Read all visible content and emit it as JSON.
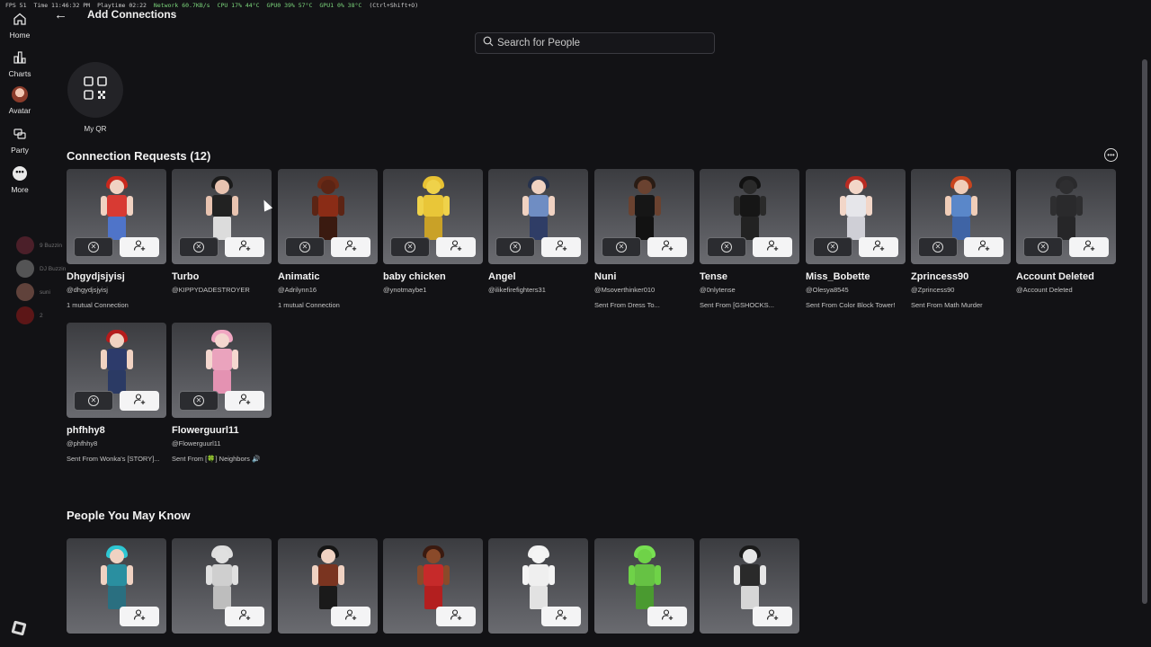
{
  "stats": {
    "fps": "FPS 51",
    "time": "Time 11:46:32 PM",
    "playtime": "Playtime 02:22",
    "network": "Network 60.7KB/s",
    "cpu": "CPU 17% 44°C",
    "gpu0": "GPU0 39% 57°C",
    "gpu1": "GPU1 0% 38°C",
    "shortcut": "(Ctrl+Shift+O)"
  },
  "nav": [
    {
      "label": "Home",
      "icon": "home-icon"
    },
    {
      "label": "Charts",
      "icon": "charts-icon"
    },
    {
      "label": "Avatar",
      "icon": "avatar-icon"
    },
    {
      "label": "Party",
      "icon": "party-icon"
    },
    {
      "label": "More",
      "icon": "more-icon"
    }
  ],
  "mini_friends": [
    "9 Buzzin",
    "DJ Buzzin",
    "suni",
    "2"
  ],
  "header": {
    "title": "Add Connections"
  },
  "search": {
    "placeholder": "Search for People"
  },
  "qr": {
    "label": "My QR"
  },
  "requests": {
    "title": "Connection Requests (12)",
    "items": [
      {
        "name": "Dhgydjsjyisj",
        "handle": "@dhgydjsjyisj",
        "extra": "1 mutual Connection",
        "hair": "#c9281d",
        "skin": "#f0d2c2",
        "torso": "#d83a33",
        "legs": "#4f74c9"
      },
      {
        "name": "Turbo",
        "handle": "@KIPPYDADESTROYER",
        "extra": "",
        "hair": "#1b1b1b",
        "skin": "#e8c3b0",
        "torso": "#222222",
        "legs": "#dcdcdc"
      },
      {
        "name": "Animatic",
        "handle": "@Adrilynn16",
        "extra": "1 mutual Connection",
        "hair": "#6b2a16",
        "skin": "#5c2414",
        "torso": "#8a2c16",
        "legs": "#3a1a10"
      },
      {
        "name": "baby chicken",
        "handle": "@ynotmaybe1",
        "extra": "",
        "hair": "#e8c233",
        "skin": "#efd24a",
        "torso": "#e9c638",
        "legs": "#c9a127"
      },
      {
        "name": "Angel",
        "handle": "@ilikefirefighters31",
        "extra": "",
        "hair": "#26324d",
        "skin": "#f0d2c2",
        "torso": "#6f8dc3",
        "legs": "#2f3d66"
      },
      {
        "name": "Nuni",
        "handle": "@Msoverthinker010",
        "extra": "Sent From Dress To...",
        "hair": "#2a1c14",
        "skin": "#6a4230",
        "torso": "#161616",
        "legs": "#121212"
      },
      {
        "name": "Tense",
        "handle": "@0nlytense",
        "extra": "Sent From [GSHOCKS...",
        "hair": "#111111",
        "skin": "#2a2a2a",
        "torso": "#161616",
        "legs": "#222222"
      },
      {
        "name": "Miss_Bobette",
        "handle": "@Olesya8545",
        "extra": "Sent From Color Block Tower!",
        "hair": "#b82b22",
        "skin": "#f2d6c8",
        "torso": "#e6e6ea",
        "legs": "#cfcfd6"
      },
      {
        "name": "Zprincess90",
        "handle": "@Zprincess90",
        "extra": "Sent From Math Murder",
        "hair": "#c8451f",
        "skin": "#f0cdb8",
        "torso": "#5a87c9",
        "legs": "#3f64a5"
      },
      {
        "name": "Account Deleted",
        "handle": "@Account Deleted",
        "extra": "",
        "hair": "#2a2a2c",
        "skin": "#2e2e30",
        "torso": "#2a2a2c",
        "legs": "#262628"
      },
      {
        "name": "phfhhy8",
        "handle": "@phfhhy8",
        "extra": "Sent From Wonka's [STORY]...",
        "hair": "#b51c1c",
        "skin": "#f0d2c2",
        "torso": "#2d3b6b",
        "legs": "#2b3a64"
      },
      {
        "name": "Flowerguurl11",
        "handle": "@Flowerguurl11",
        "extra": "Sent From [🍀] Neighbors 🔊",
        "hair": "#f1a7c2",
        "skin": "#f4d7cf",
        "torso": "#eaa3bd",
        "legs": "#e492b2"
      }
    ]
  },
  "suggestions": {
    "title": "People You May Know",
    "items": [
      {
        "hair": "#2ec7d3",
        "skin": "#f0d2c2",
        "torso": "#2a8fa0",
        "legs": "#2a6f80"
      },
      {
        "hair": "#dedede",
        "skin": "#e0e0e0",
        "torso": "#cfcfcf",
        "legs": "#bdbdbd"
      },
      {
        "hair": "#151515",
        "skin": "#f0d2c2",
        "torso": "#7a3420",
        "legs": "#1a1a1a"
      },
      {
        "hair": "#3a1a10",
        "skin": "#8a4a2a",
        "torso": "#c62a2a",
        "legs": "#b31f1f"
      },
      {
        "hair": "#f2f2f2",
        "skin": "#f4f4f4",
        "torso": "#efefef",
        "legs": "#e2e2e2"
      },
      {
        "hair": "#78e052",
        "skin": "#6fd248",
        "torso": "#66c244",
        "legs": "#4a9a30"
      },
      {
        "hair": "#1a1a1a",
        "skin": "#e6e6e6",
        "torso": "#2a2a2a",
        "legs": "#d6d6d6"
      }
    ]
  }
}
